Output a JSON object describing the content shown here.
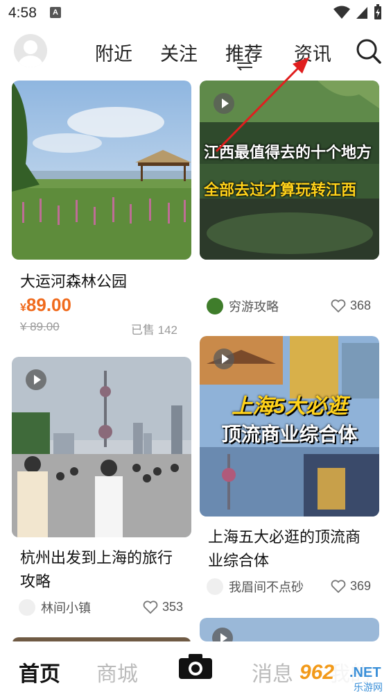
{
  "status_bar": {
    "time": "4:58",
    "notif_icon": "A"
  },
  "top_nav": {
    "tabs": [
      "附近",
      "关注",
      "推荐",
      "资讯"
    ],
    "active_tab": "推荐"
  },
  "feed": {
    "left": [
      {
        "title": "大运河森林公园",
        "currency": "¥",
        "price": "89.00",
        "original_price": "¥ 89.00",
        "sold": "已售 142"
      },
      {
        "title_line1": "杭州出发到上海的旅行",
        "title_line2": "攻略",
        "author": "林间小镇",
        "likes": "353"
      }
    ],
    "right": [
      {
        "overlay_line1": "江西最值得去的十个地方",
        "overlay_line2": "全部去过才算玩转江西",
        "author": "穷游攻略",
        "likes": "368"
      },
      {
        "overlay_line1": "上海5大必逛",
        "overlay_line2": "顶流商业综合体",
        "title_line1": "上海五大必逛的顶流商",
        "title_line2": "业综合体",
        "author": "我眉间不点砂",
        "likes": "369"
      }
    ]
  },
  "bottom_nav": {
    "items": [
      "首页",
      "商城",
      "消息",
      "我的"
    ],
    "active": "首页"
  },
  "watermark": {
    "num": "962",
    "net": ".NET",
    "sub": "乐游网"
  },
  "colors": {
    "price": "#f06a1c",
    "arrow": "#e01e1e",
    "overlay_yellow": "#ffd21a"
  }
}
